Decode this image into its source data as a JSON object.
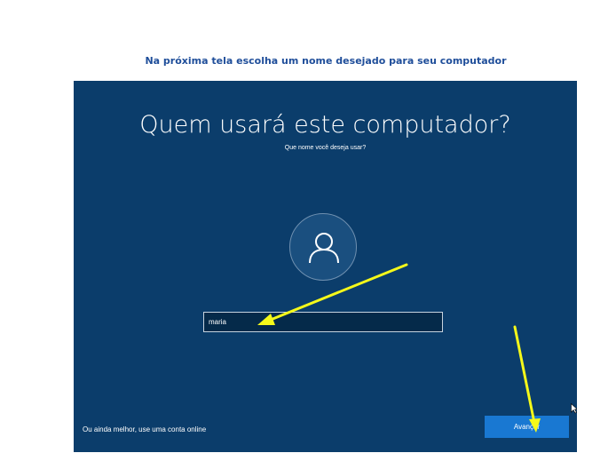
{
  "caption": "Na próxima tela escolha um nome desejado para seu computador",
  "screen": {
    "title": "Quem usará este computador?",
    "subtitle": "Que nome você deseja usar?",
    "avatar_icon": "person-icon",
    "name_input_value": "maria",
    "online_account_link": "Ou ainda melhor, use uma conta online",
    "next_button_label": "Avançar"
  },
  "colors": {
    "screen_background": "#0b3d6b",
    "button": "#1978d2",
    "caption": "#1f4e9a",
    "annotation_arrow": "#f5f91a"
  }
}
